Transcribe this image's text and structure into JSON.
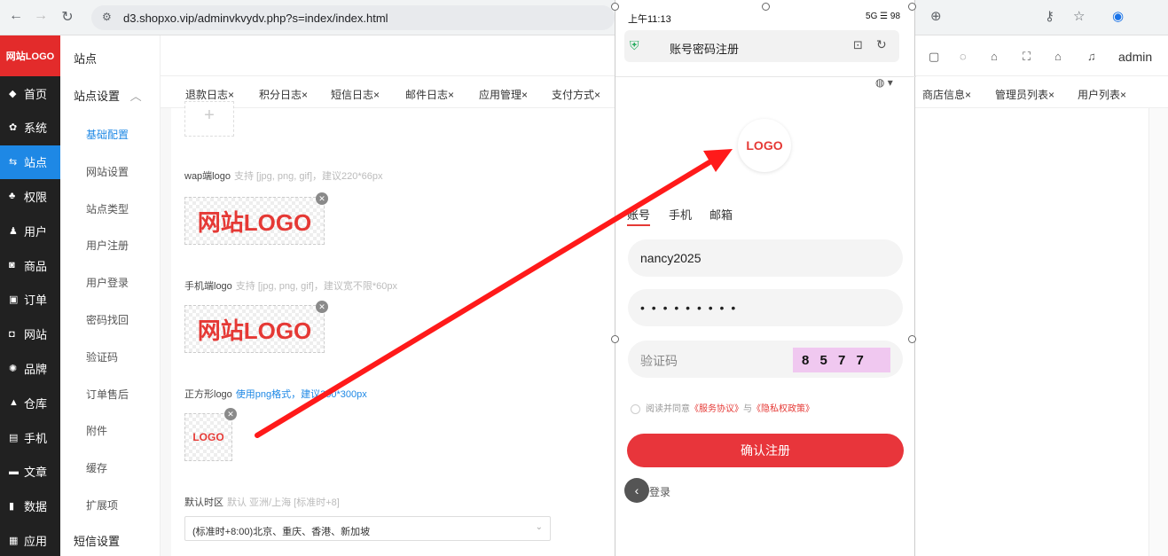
{
  "browser": {
    "url": "d3.shopxo.vip/adminvkvydv.php?s=index/index.html",
    "admin_label": "admin"
  },
  "sidebar": {
    "logo": "网站LOGO",
    "items": [
      {
        "icon": "home-icon",
        "glyph": "◆",
        "label": "首页"
      },
      {
        "icon": "gear-icon",
        "glyph": "✿",
        "label": "系统"
      },
      {
        "icon": "sliders-icon",
        "glyph": "⇆",
        "label": "站点"
      },
      {
        "icon": "user-key-icon",
        "glyph": "♣",
        "label": "权限"
      },
      {
        "icon": "user-icon",
        "glyph": "♟",
        "label": "用户"
      },
      {
        "icon": "goods-icon",
        "glyph": "◙",
        "label": "商品"
      },
      {
        "icon": "order-icon",
        "glyph": "▣",
        "label": "订单"
      },
      {
        "icon": "web-icon",
        "glyph": "◘",
        "label": "网站"
      },
      {
        "icon": "brand-icon",
        "glyph": "✺",
        "label": "品牌"
      },
      {
        "icon": "warehouse-icon",
        "glyph": "▲",
        "label": "仓库"
      },
      {
        "icon": "mobile-icon",
        "glyph": "▤",
        "label": "手机"
      },
      {
        "icon": "article-icon",
        "glyph": "▬",
        "label": "文章"
      },
      {
        "icon": "chart-icon",
        "glyph": "▮",
        "label": "数据"
      },
      {
        "icon": "apps-icon",
        "glyph": "▦",
        "label": "应用"
      }
    ]
  },
  "submenu": {
    "header": "站点",
    "group": "站点设置",
    "items": [
      "基础配置",
      "网站设置",
      "站点类型",
      "用户注册",
      "用户登录",
      "密码找回",
      "验证码",
      "订单售后",
      "附件",
      "缓存",
      "扩展项"
    ],
    "next_group": "短信设置"
  },
  "tabs": {
    "left": [
      "退款日志×",
      "积分日志×",
      "短信日志×",
      "邮件日志×",
      "应用管理×",
      "支付方式×"
    ],
    "right": [
      "商店信息×",
      "管理员列表×",
      "用户列表×"
    ]
  },
  "form": {
    "wap_logo_label": "wap端logo",
    "wap_logo_hint": "支持 [jpg, png, gif]，建议220*66px",
    "mobile_logo_label": "手机端logo",
    "mobile_logo_hint": "支持 [jpg, png, gif]，建议宽不限*60px",
    "square_logo_label": "正方形logo",
    "square_logo_hint": "使用png格式，建议300*300px",
    "logo_text": "网站LOGO",
    "small_logo_text": "LOGO",
    "timezone_label": "默认时区",
    "timezone_hint": "默认 亚洲/上海 [标准时+8]",
    "timezone_value": "(标准时+8:00)北京、重庆、香港、新加坡"
  },
  "phone": {
    "time": "上午11:13",
    "status_right": "5G ☰ 98",
    "page_title": "账号密码注册",
    "logo_text": "LOGO",
    "tabs": [
      "账号",
      "手机",
      "邮箱"
    ],
    "username": "nancy2025",
    "password_mask": "• • • • • • • • •",
    "captcha_placeholder": "验证码",
    "captcha_code": "8 5 7 7",
    "agree_prefix": "阅读并同意",
    "terms": "《服务协议》",
    "and": "与",
    "privacy": "《隐私权政策》",
    "submit": "确认注册",
    "login": "登录"
  },
  "colors": {
    "accent_blue": "#1e88e5",
    "brand_red": "#e53935",
    "arrow_red": "#ff1a1a"
  }
}
